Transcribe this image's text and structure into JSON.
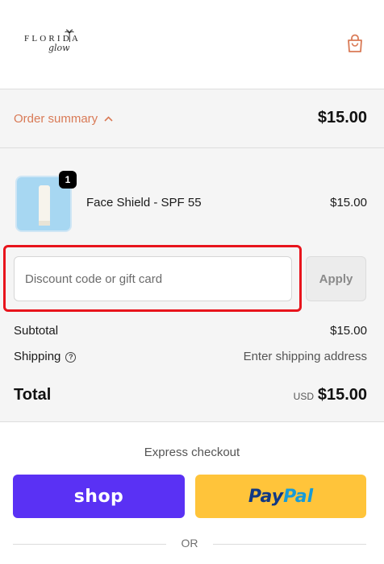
{
  "header": {
    "logo_top": "FLORIDA",
    "logo_sub": "glow",
    "cart_icon": "shopping-bag-icon"
  },
  "summary": {
    "toggle_label": "Order summary",
    "toggle_icon": "chevron-up-icon",
    "total": "$15.00"
  },
  "items": [
    {
      "name": "Face Shield - SPF 55",
      "price": "$15.00",
      "quantity": "1"
    }
  ],
  "discount": {
    "placeholder": "Discount code or gift card",
    "value": "",
    "apply_label": "Apply"
  },
  "totals": {
    "subtotal_label": "Subtotal",
    "subtotal_value": "$15.00",
    "shipping_label": "Shipping",
    "shipping_value": "Enter shipping address",
    "total_label": "Total",
    "currency": "USD",
    "total_value": "$15.00"
  },
  "express": {
    "title": "Express checkout",
    "shop_label": "shop",
    "paypal_part1": "Pay",
    "paypal_part2": "Pal"
  },
  "divider": {
    "or_label": "OR"
  },
  "colors": {
    "accent": "#d97a56",
    "shop_pay": "#5a31f4",
    "paypal": "#ffc43a",
    "highlight": "#e8141c"
  }
}
